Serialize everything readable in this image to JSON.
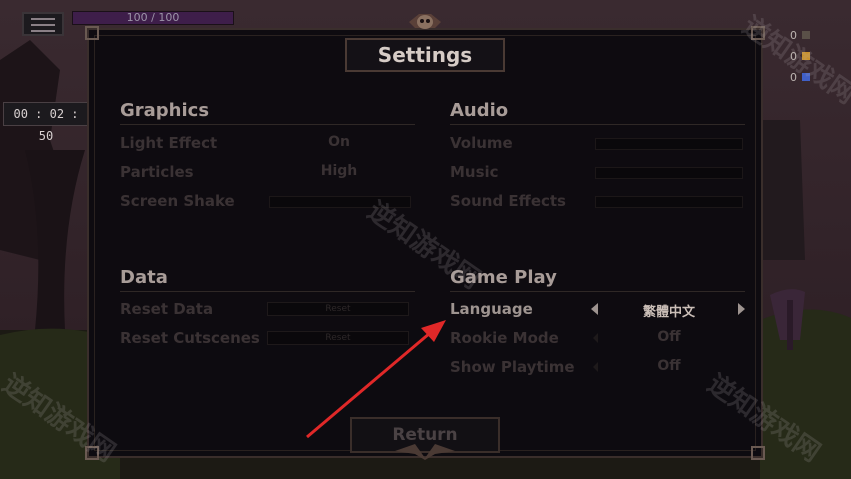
{
  "hud": {
    "hp_text": "100 / 100",
    "timer": "00 : 02 : 50",
    "resources": [
      "0",
      "0",
      "0"
    ]
  },
  "settings": {
    "title": "Settings",
    "graphics": {
      "title": "Graphics",
      "rows": [
        {
          "label": "Light Effect",
          "value": "On"
        },
        {
          "label": "Particles",
          "value": "High"
        },
        {
          "label": "Screen Shake",
          "value": ""
        }
      ]
    },
    "audio": {
      "title": "Audio",
      "rows": [
        {
          "label": "Volume"
        },
        {
          "label": "Music"
        },
        {
          "label": "Sound Effects"
        }
      ]
    },
    "data": {
      "title": "Data",
      "rows": [
        {
          "label": "Reset Data",
          "button": "Reset"
        },
        {
          "label": "Reset Cutscenes",
          "button": "Reset"
        }
      ]
    },
    "gameplay": {
      "title": "Game Play",
      "rows": [
        {
          "label": "Language",
          "value": "繁體中文"
        },
        {
          "label": "Rookie Mode",
          "value": "Off"
        },
        {
          "label": "Show Playtime",
          "value": "Off"
        }
      ]
    },
    "return_label": "Return"
  },
  "watermark": "逆知游戏网",
  "colors": {
    "annotation_arrow": "#e02828",
    "hp_bar": "#3e1e4a",
    "panel_bg": "#0d0b10"
  }
}
